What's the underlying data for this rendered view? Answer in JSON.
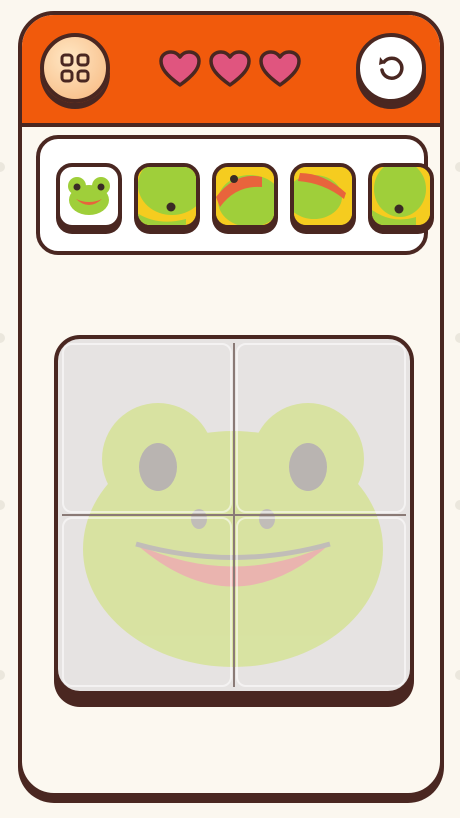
{
  "header": {
    "menu_icon": "grid-four-icon",
    "reset_icon": "restart-icon",
    "accent_color": "#f15a0c"
  },
  "lives": {
    "total": 3,
    "remaining": 3,
    "heart_color": "#e0557f"
  },
  "tray": {
    "reference_icon": "frog-face-icon",
    "pieces": [
      {
        "id": "piece-1",
        "quadrant": "bottom-left"
      },
      {
        "id": "piece-2",
        "quadrant": "top-left"
      },
      {
        "id": "piece-3",
        "quadrant": "top-right"
      },
      {
        "id": "piece-4",
        "quadrant": "bottom-right"
      }
    ]
  },
  "board": {
    "rows": 2,
    "cols": 2,
    "placed": 0,
    "hint_image": "frog-face"
  }
}
